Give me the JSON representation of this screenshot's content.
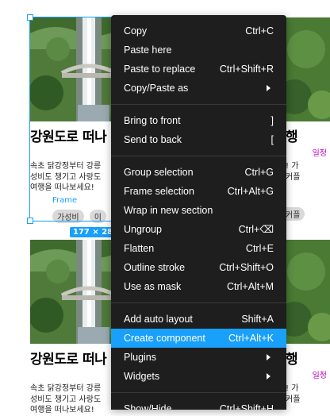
{
  "canvas": {
    "cards": [
      {
        "title": "강원도로 떠나",
        "desc_lines": [
          "속초 닭강정부터 강릉 ",
          "성비도 챙기고 사랑도 ",
          "여행을 떠나보세요!"
        ],
        "tags": [
          "가성비",
          "이"
        ]
      },
      {
        "title": "강원도로 떠나",
        "desc_lines": [
          "속초 닭강정부터 강릉 ",
          "성비도 챙기고 사랑도 ",
          "여행을 떠나보세요!"
        ]
      }
    ],
    "right_cards": [
      {
        "title": "행",
        "sub": "일정",
        "desc_lines": [
          "! 가",
          "커플"
        ],
        "tag": "커플"
      },
      {
        "title": "행",
        "sub": "일정",
        "desc_lines": [
          "! 가",
          "커플"
        ]
      }
    ],
    "selection": {
      "frame_label": "Frame",
      "size_label": "177 × 285"
    }
  },
  "menu": {
    "groups": [
      [
        {
          "label": "Copy",
          "shortcut": "Ctrl+C"
        },
        {
          "label": "Paste here",
          "shortcut": ""
        },
        {
          "label": "Paste to replace",
          "shortcut": "Ctrl+Shift+R"
        },
        {
          "label": "Copy/Paste as",
          "shortcut": "",
          "submenu": true
        }
      ],
      [
        {
          "label": "Bring to front",
          "shortcut": "]"
        },
        {
          "label": "Send to back",
          "shortcut": "["
        }
      ],
      [
        {
          "label": "Group selection",
          "shortcut": "Ctrl+G"
        },
        {
          "label": "Frame selection",
          "shortcut": "Ctrl+Alt+G"
        },
        {
          "label": "Wrap in new section",
          "shortcut": ""
        },
        {
          "label": "Ungroup",
          "shortcut": "Ctrl+⌫"
        },
        {
          "label": "Flatten",
          "shortcut": "Ctrl+E"
        },
        {
          "label": "Outline stroke",
          "shortcut": "Ctrl+Shift+O"
        },
        {
          "label": "Use as mask",
          "shortcut": "Ctrl+Alt+M"
        }
      ],
      [
        {
          "label": "Add auto layout",
          "shortcut": "Shift+A"
        },
        {
          "label": "Create component",
          "shortcut": "Ctrl+Alt+K",
          "active": true
        },
        {
          "label": "Plugins",
          "shortcut": "",
          "submenu": true
        },
        {
          "label": "Widgets",
          "shortcut": "",
          "submenu": true
        }
      ],
      [
        {
          "label": "Show/Hide",
          "shortcut": "Ctrl+Shift+H"
        }
      ]
    ]
  },
  "colors": {
    "accent": "#18a0fb",
    "menu_bg": "#1e1e1e",
    "magenta": "#c000c0"
  }
}
